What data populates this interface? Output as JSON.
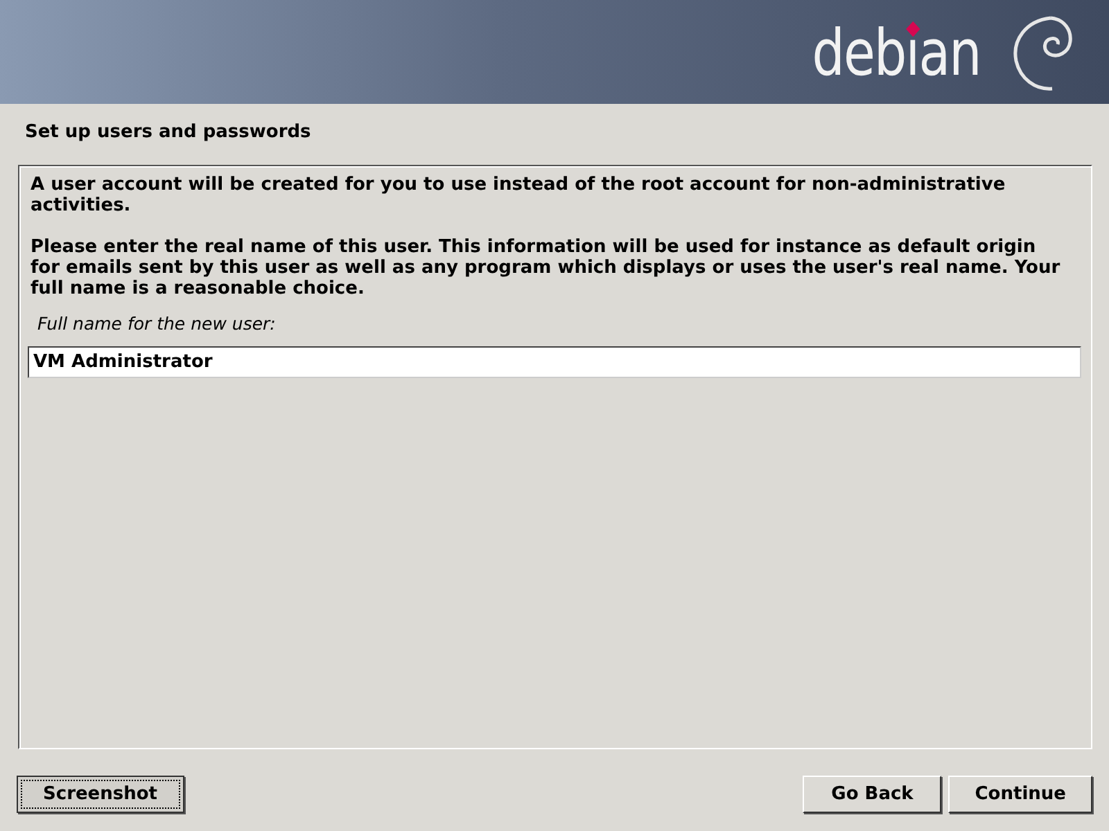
{
  "banner": {
    "logo_text": "debian"
  },
  "step_title": "Set up users and passwords",
  "paragraphs": [
    "A user account will be created for you to use instead of the root account for non-administrative activities.",
    "Please enter the real name of this user. This information will be used for instance as default origin for emails sent by this user as well as any program which displays or uses the user's real name. Your full name is a reasonable choice."
  ],
  "field": {
    "label": "Full name for the new user:",
    "value": "VM Administrator"
  },
  "buttons": [
    {
      "label": "Screenshot",
      "focused": true,
      "kind": "utility"
    },
    {
      "label": "Go Back",
      "focused": false,
      "kind": "navigation"
    },
    {
      "label": "Continue",
      "focused": false,
      "kind": "navigation"
    }
  ]
}
